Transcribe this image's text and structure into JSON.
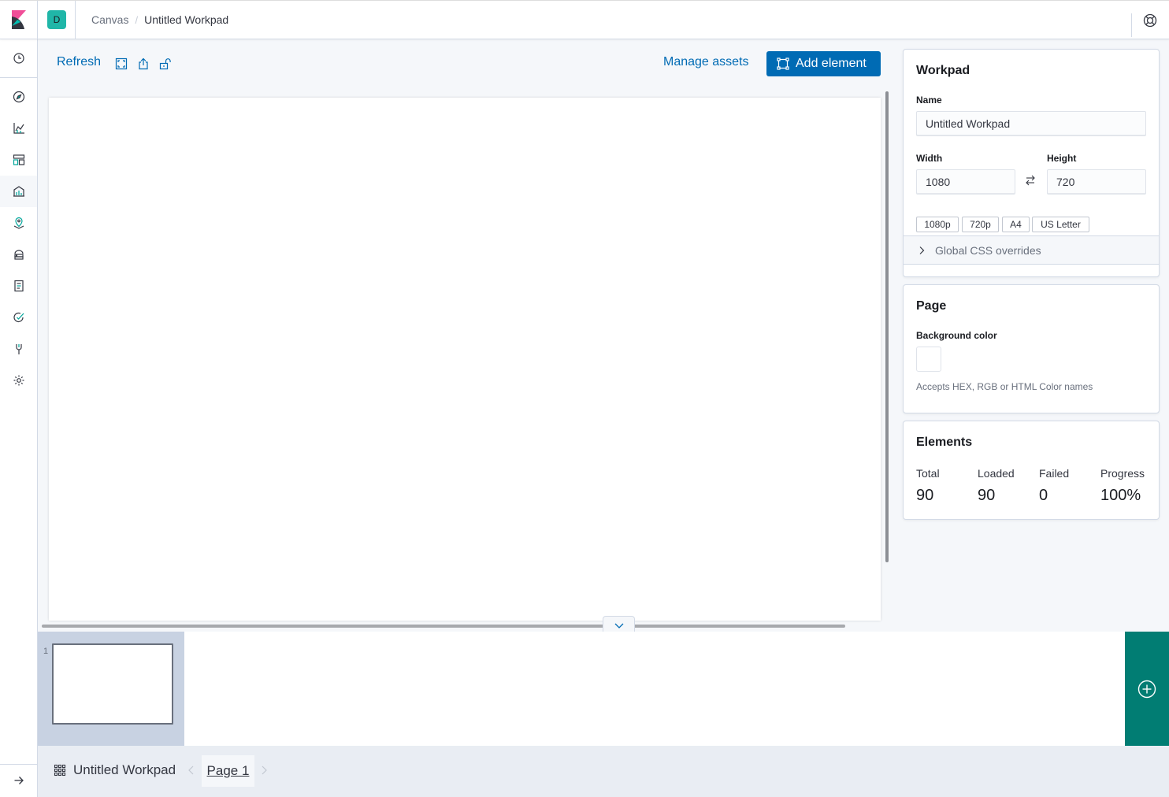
{
  "header": {
    "space_initial": "D",
    "breadcrumbs": [
      "Canvas",
      "Untitled Workpad"
    ],
    "separator": "/"
  },
  "nav": {
    "icons": [
      "clock-icon",
      "compass-icon",
      "visualize-icon",
      "dashboard-icon",
      "canvas-icon",
      "maps-icon",
      "infrastructure-icon",
      "logs-icon",
      "uptime-icon",
      "devtools-icon",
      "management-icon"
    ],
    "collapse_icon": "arrow-right-icon"
  },
  "toolbar": {
    "refresh": "Refresh",
    "manage_assets": "Manage assets",
    "add_element": "Add element"
  },
  "sidebar": {
    "workpad": {
      "title": "Workpad",
      "name_label": "Name",
      "name_value": "Untitled Workpad",
      "width_label": "Width",
      "width_value": "1080",
      "height_label": "Height",
      "height_value": "720",
      "presets": [
        "1080p",
        "720p",
        "A4",
        "US Letter"
      ],
      "css_overrides": "Global CSS overrides"
    },
    "page": {
      "title": "Page",
      "bg_label": "Background color",
      "help": "Accepts HEX, RGB or HTML Color names",
      "bg_color": "#ffffff"
    },
    "elements": {
      "title": "Elements",
      "stats": [
        {
          "label": "Total",
          "value": "90"
        },
        {
          "label": "Loaded",
          "value": "90"
        },
        {
          "label": "Failed",
          "value": "0"
        },
        {
          "label": "Progress",
          "value": "100%"
        }
      ]
    }
  },
  "page_manager": {
    "pages": [
      {
        "number": "1"
      }
    ]
  },
  "footer": {
    "workpad_name": "Untitled Workpad",
    "current_page": "Page 1"
  },
  "colors": {
    "primary": "#006bb4",
    "add_page": "#017d73",
    "space_avatar": "#20b6a8"
  }
}
